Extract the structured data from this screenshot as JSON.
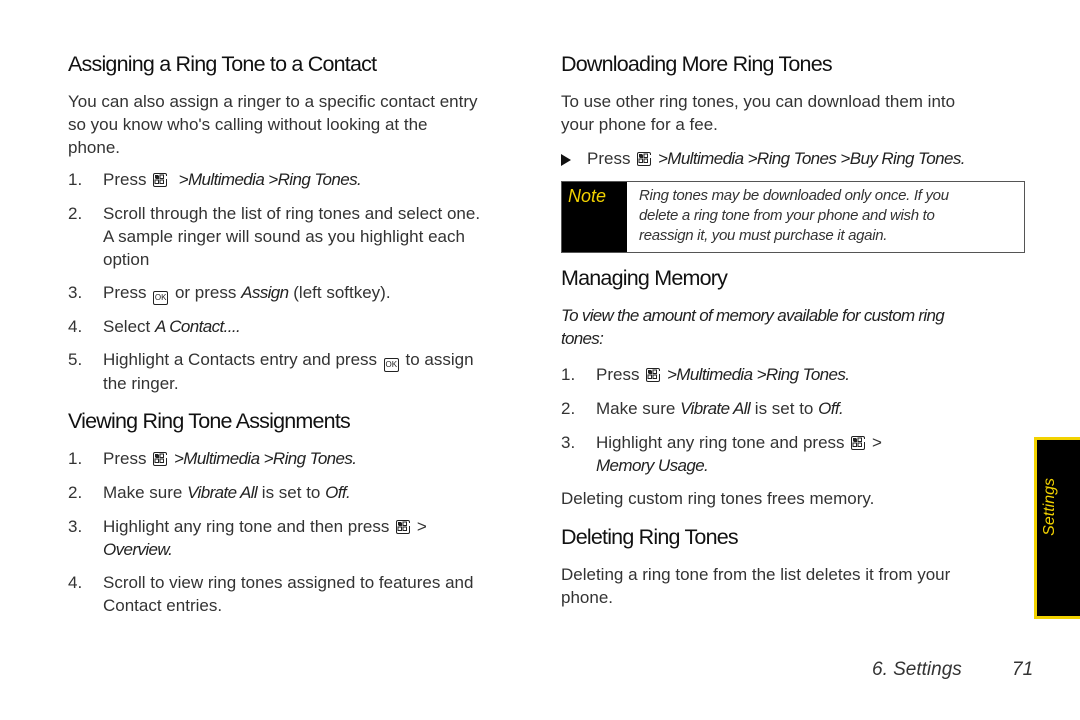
{
  "left": {
    "assigning": {
      "title": "Assigning a Ring Tone to a Contact",
      "intro": [
        "You can also assign a ringer to a specific contact entry",
        "so you know who's calling without looking at the",
        "phone."
      ],
      "steps": [
        {
          "num": "1.",
          "pre": "Press",
          "key": "menu-key-icon",
          "path": ">Multimedia >Ring Tones."
        },
        {
          "num": "2.",
          "lines": [
            "Scroll through the list of ring tones and select one.",
            "A sample ringer will sound as you highlight each",
            "option"
          ]
        },
        {
          "num": "3.",
          "pre": "Press",
          "key": "ok-key-icon",
          "key_label": "OK",
          "mid": "or press",
          "em": "Assign",
          "post": "(left softkey)."
        },
        {
          "num": "4.",
          "pre": "Select",
          "em": "A Contact...."
        },
        {
          "num": "5.",
          "pre": "Highlight a Contacts entry and press",
          "key_label": "OK",
          "post": "to assign",
          "line2": "the ringer."
        }
      ]
    },
    "viewing": {
      "title": "Viewing Ring Tone Assignments",
      "steps": [
        {
          "num": "1.",
          "pre": "Press",
          "path": ">Multimedia >Ring Tones."
        },
        {
          "num": "2.",
          "pre": "Make sure",
          "em": "Vibrate All",
          "mid": "is set to",
          "em2": "Off."
        },
        {
          "num": "3.",
          "pre": "Highlight any ring tone and then press",
          "post": ">",
          "line2": "Overview."
        },
        {
          "num": "4.",
          "lines": [
            "Scroll to view ring tones assigned to features and",
            "Contact entries."
          ]
        }
      ]
    }
  },
  "right": {
    "downloading": {
      "title": "Downloading More Ring Tones",
      "intro": [
        "To use other ring tones, you can download them into",
        "your phone for a fee."
      ],
      "bullet": {
        "pre": "Press",
        "path": ">Multimedia >Ring Tones >Buy Ring Tones."
      },
      "note": {
        "label": "Note",
        "lines": [
          "Ring tones may be downloaded only once. If you",
          "delete a ring tone from your phone and wish to",
          "reassign it, you must purchase it again."
        ]
      }
    },
    "memory": {
      "title": "Managing Memory",
      "intro": [
        "To view the amount of memory available for custom ring",
        "tones:"
      ],
      "steps": [
        {
          "num": "1.",
          "pre": "Press",
          "path": ">Multimedia >Ring Tones."
        },
        {
          "num": "2.",
          "pre": "Make sure",
          "em": "Vibrate All",
          "mid": "is set to",
          "em2": "Off."
        },
        {
          "num": "3.",
          "pre": "Highlight any ring tone and press",
          "post": ">",
          "line2": "Memory Usage."
        }
      ],
      "outro": "Deleting custom ring tones frees memory."
    },
    "deleting": {
      "title": "Deleting Ring Tones",
      "body": [
        "Deleting a ring tone from the list deletes it from your",
        "phone."
      ]
    }
  },
  "side_tab": {
    "label": "Settings",
    "accent": "#f2d200"
  },
  "footer": {
    "section": "6. Settings",
    "page": "71"
  }
}
